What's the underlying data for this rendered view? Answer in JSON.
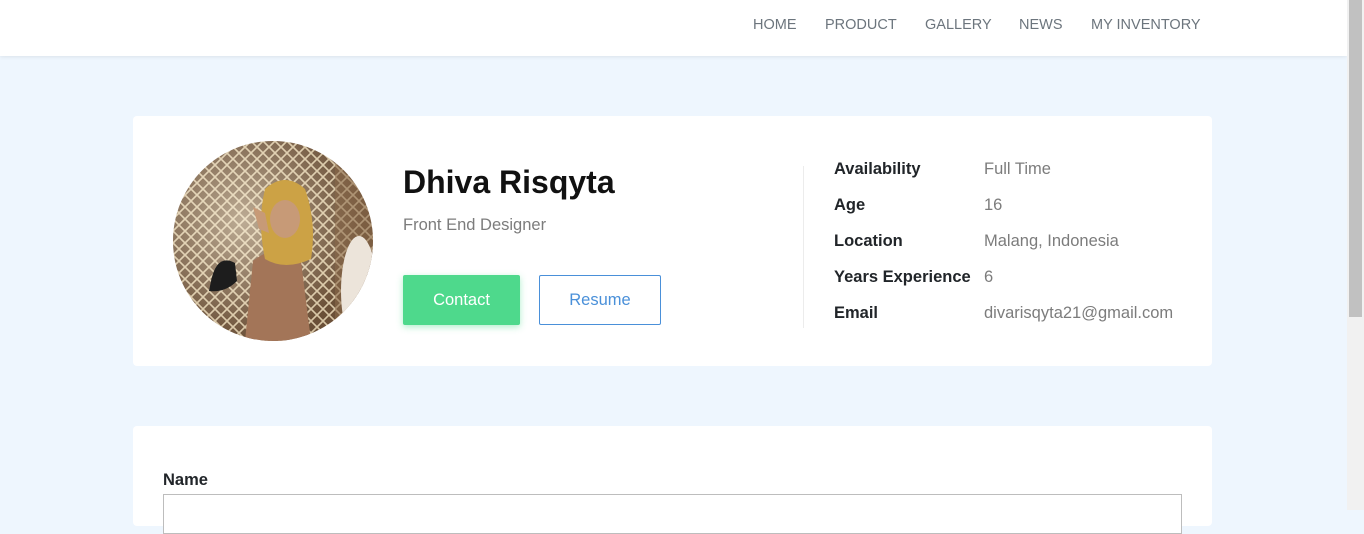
{
  "nav": {
    "items": [
      "HOME",
      "PRODUCT",
      "GALLERY",
      "NEWS",
      "MY INVENTORY"
    ]
  },
  "profile": {
    "name": "Dhiva Risqyta",
    "title": "Front End Designer",
    "contact_label": "Contact",
    "resume_label": "Resume"
  },
  "info": {
    "availability_label": "Availability",
    "availability_value": "Full Time",
    "age_label": "Age",
    "age_value": "16",
    "location_label": "Location",
    "location_value": "Malang, Indonesia",
    "experience_label": "Years Experience",
    "experience_value": "6",
    "email_label": "Email",
    "email_value": "divarisqyta21@gmail.com"
  },
  "form": {
    "name_label": "Name",
    "name_value": ""
  },
  "colors": {
    "page_bg": "#eef6fe",
    "contact_button": "#4ed98c",
    "resume_button": "#4a90d9"
  }
}
